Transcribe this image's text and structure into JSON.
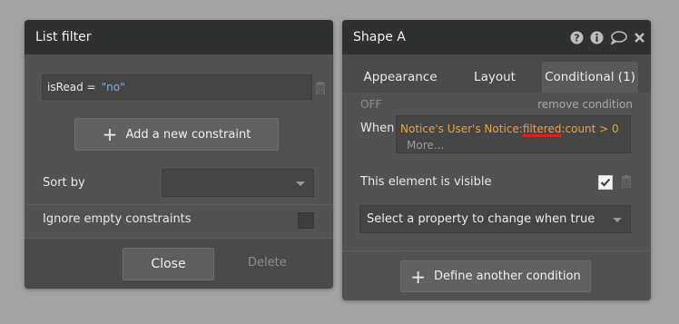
{
  "list_filter": {
    "title": "List filter",
    "constraint": {
      "field": "isRead =",
      "value": "\"no\""
    },
    "add_constraint_label": "Add a new constraint",
    "sort_by_label": "Sort by",
    "sort_by_value": "",
    "ignore_empty_label": "Ignore empty constraints",
    "close_label": "Close",
    "delete_label": "Delete"
  },
  "shape_a": {
    "title": "Shape A",
    "header_icons": [
      "help-icon",
      "info-icon",
      "comment-icon",
      "close-icon"
    ],
    "tabs": [
      {
        "label": "Appearance",
        "active": false
      },
      {
        "label": "Layout",
        "active": false
      },
      {
        "label": "Conditional (1)",
        "active": true
      }
    ],
    "off_label": "OFF",
    "remove_condition_label": "remove condition",
    "when_label": "When",
    "when_expression": {
      "part1": "Notice's User's Notice:",
      "highlight": "filtered",
      "part2": ":count > 0"
    },
    "more_label": "More...",
    "visible_label": "This element is visible",
    "visible_checked": true,
    "property_placeholder": "Select a property to change when true",
    "define_condition_label": "Define another condition"
  },
  "colors": {
    "panel_bg": "#525252",
    "header_bg": "#2f3030",
    "expression_orange": "#f0a23a",
    "value_blue": "#7fb0e0",
    "highlight_red": "#e02020"
  }
}
